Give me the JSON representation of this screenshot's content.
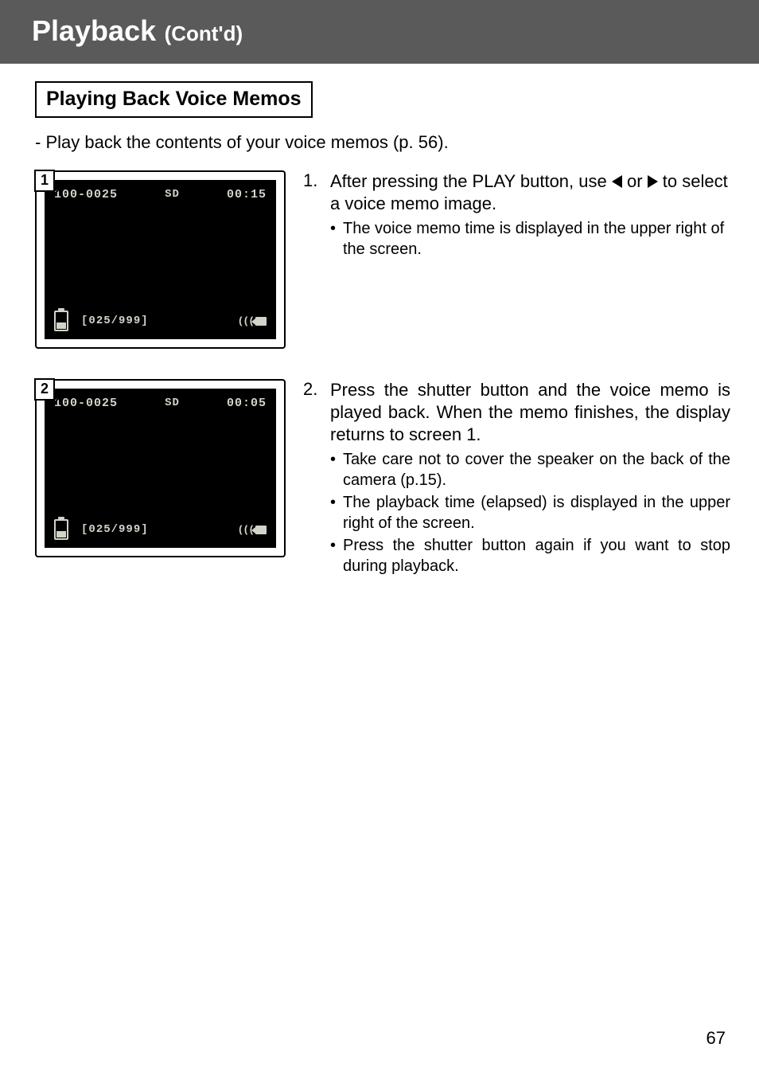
{
  "header": {
    "title": "Playback",
    "subtitle": "(Cont'd)"
  },
  "section": {
    "heading": "Playing Back Voice Memos",
    "intro": "-  Play back the contents of your voice memos (p. 56)."
  },
  "figures": [
    {
      "num": "1",
      "top_left": "100-0025",
      "top_center": "SD",
      "top_right": "00:15",
      "counter": "[025/999]"
    },
    {
      "num": "2",
      "top_left": "100-0025",
      "top_center": "SD",
      "top_right": "00:05",
      "counter": "[025/999]"
    }
  ],
  "steps": [
    {
      "num": "1.",
      "text_before_arrows": "After pressing the PLAY button, use ",
      "text_between_arrows": " or ",
      "text_after_arrows": " to select a voice memo image.",
      "bullets": [
        "The voice memo time is displayed in the upper right of the screen."
      ]
    },
    {
      "num": "2.",
      "text": "Press the shutter button and the voice memo is played back. When the memo finishes, the display returns to screen 1.",
      "bullets": [
        "Take care not to cover the speaker on the back of the camera (p.15).",
        "The playback time (elapsed) is displayed in the upper right of the screen.",
        "Press the shutter button again if you want to stop during playback."
      ]
    }
  ],
  "page_number": "67"
}
